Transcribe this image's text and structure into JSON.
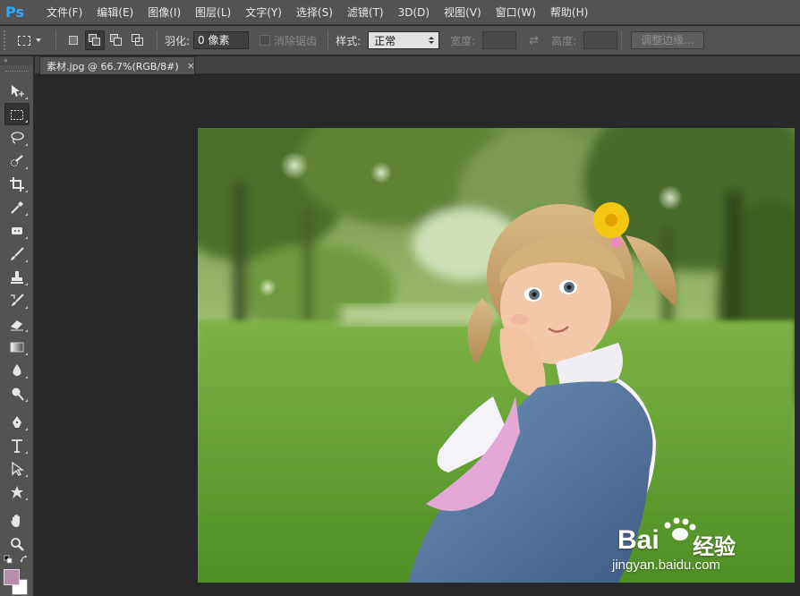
{
  "app": {
    "logo": "Ps",
    "accent_color": "#31a8ff"
  },
  "menu": [
    {
      "label": "文件(F)"
    },
    {
      "label": "编辑(E)"
    },
    {
      "label": "图像(I)"
    },
    {
      "label": "图层(L)"
    },
    {
      "label": "文字(Y)"
    },
    {
      "label": "选择(S)"
    },
    {
      "label": "滤镜(T)"
    },
    {
      "label": "3D(D)"
    },
    {
      "label": "视图(V)"
    },
    {
      "label": "窗口(W)"
    },
    {
      "label": "帮助(H)"
    }
  ],
  "options": {
    "feather_label": "羽化:",
    "feather_value": "0 像素",
    "antialias_label": "消除锯齿",
    "style_label": "样式:",
    "style_value": "正常",
    "width_label": "宽度:",
    "height_label": "高度:",
    "refine_edge_label": "调整边缘..."
  },
  "toolbar": {
    "collapse_glyph": "»",
    "tools": [
      {
        "name": "move-tool",
        "icon": "move-icon"
      },
      {
        "name": "rect-marquee-tool",
        "icon": "marquee-icon",
        "active": true
      },
      {
        "name": "lasso-tool",
        "icon": "lasso-icon"
      },
      {
        "name": "quick-select-tool",
        "icon": "quick-select-icon"
      },
      {
        "name": "crop-tool",
        "icon": "crop-icon"
      },
      {
        "name": "eyedropper-tool",
        "icon": "eyedropper-icon"
      },
      {
        "name": "spot-healing-tool",
        "icon": "healing-icon"
      },
      {
        "name": "brush-tool",
        "icon": "brush-icon"
      },
      {
        "name": "clone-stamp-tool",
        "icon": "stamp-icon"
      },
      {
        "name": "history-brush-tool",
        "icon": "history-brush-icon"
      },
      {
        "name": "eraser-tool",
        "icon": "eraser-icon"
      },
      {
        "name": "gradient-tool",
        "icon": "gradient-icon"
      },
      {
        "name": "blur-tool",
        "icon": "blur-icon"
      },
      {
        "name": "dodge-tool",
        "icon": "dodge-icon"
      },
      {
        "name": "pen-tool",
        "icon": "pen-icon"
      },
      {
        "name": "type-tool",
        "icon": "type-icon"
      },
      {
        "name": "path-select-tool",
        "icon": "path-select-icon"
      },
      {
        "name": "custom-shape-tool",
        "icon": "shape-icon"
      },
      {
        "name": "hand-tool",
        "icon": "hand-icon"
      },
      {
        "name": "zoom-tool",
        "icon": "zoom-icon"
      }
    ],
    "foreground_color": "#b48fac",
    "background_color": "#ffffff"
  },
  "document": {
    "tab_label": "素材.jpg @ 66.7%(RGB/8#)",
    "close_glyph": "×"
  },
  "watermark": {
    "brand": "Bai",
    "brand_suffix": "经验",
    "url": "jingyan.baidu.com"
  }
}
